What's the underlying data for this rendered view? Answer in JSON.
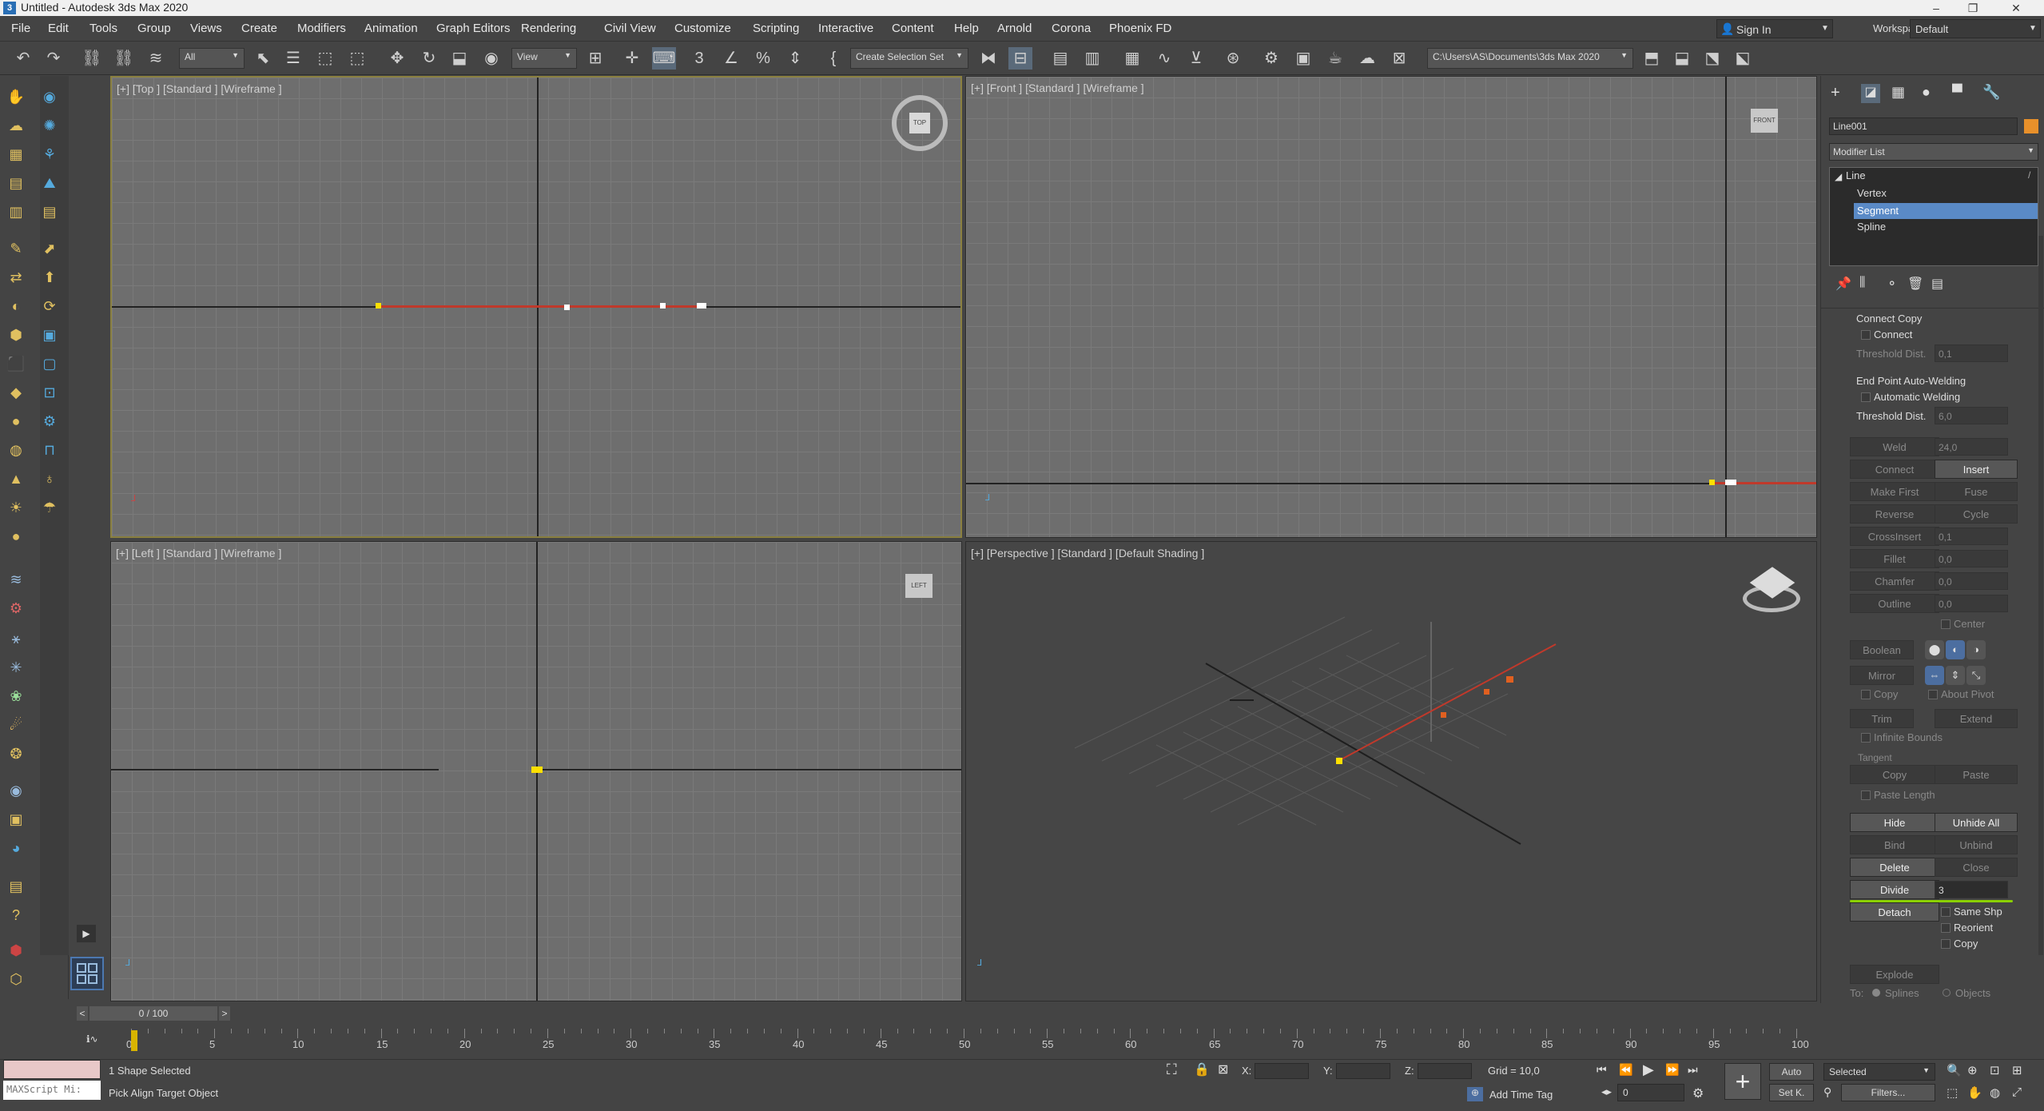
{
  "app": {
    "title": "Untitled - Autodesk 3ds Max 2020"
  },
  "menu": [
    "File",
    "Edit",
    "Tools",
    "Group",
    "Views",
    "Create",
    "Modifiers",
    "Animation",
    "Graph Editors",
    "Rendering",
    "Civil View",
    "Customize",
    "Scripting",
    "Interactive",
    "Content",
    "Help",
    "Arnold",
    "Corona",
    "Phoenix FD"
  ],
  "account": {
    "sign_in": "Sign In",
    "workspaces_label": "Workspaces:",
    "workspace": "Default"
  },
  "toolbar": {
    "filter": "All",
    "ref_coord": "View",
    "selection_set": "Create Selection Set",
    "project_path": "C:\\Users\\AS\\Documents\\3ds Max 2020"
  },
  "viewports": {
    "top": {
      "label": "[+] [Top ] [Standard ] [Wireframe ]"
    },
    "front": {
      "label": "[+] [Front ] [Standard ] [Wireframe ]"
    },
    "left": {
      "label": "[+] [Left ] [Standard ] [Wireframe ]"
    },
    "persp": {
      "label": "[+] [Perspective ] [Standard ] [Default Shading ]"
    }
  },
  "command_panel": {
    "object_name": "Line001",
    "object_color": "#e8902a",
    "modifier_list": "Modifier List",
    "stack": {
      "root": "Line",
      "items": [
        "Vertex",
        "Segment",
        "Spline"
      ],
      "selected": "Segment"
    },
    "connect_copy": {
      "title": "Connect Copy",
      "connect": "Connect",
      "threshold_label": "Threshold Dist.",
      "threshold": "0,1"
    },
    "auto_weld": {
      "title": "End Point Auto-Welding",
      "auto": "Automatic Welding",
      "threshold_label": "Threshold Dist.",
      "threshold": "6,0"
    },
    "buttons": {
      "weld": "Weld",
      "weld_val": "24,0",
      "connect": "Connect",
      "insert": "Insert",
      "make_first": "Make First",
      "fuse": "Fuse",
      "reverse": "Reverse",
      "cycle": "Cycle",
      "crossinsert": "CrossInsert",
      "crossinsert_val": "0,1",
      "fillet": "Fillet",
      "fillet_val": "0,0",
      "chamfer": "Chamfer",
      "chamfer_val": "0,0",
      "outline": "Outline",
      "outline_val": "0,0",
      "center": "Center",
      "boolean": "Boolean",
      "mirror": "Mirror",
      "copy": "Copy",
      "about_pivot": "About Pivot",
      "trim": "Trim",
      "extend": "Extend",
      "infinite_bounds": "Infinite Bounds",
      "tangent": "Tangent",
      "t_copy": "Copy",
      "t_paste": "Paste",
      "paste_length": "Paste Length",
      "hide": "Hide",
      "unhide_all": "Unhide All",
      "bind": "Bind",
      "unbind": "Unbind",
      "delete": "Delete",
      "close": "Close",
      "divide": "Divide",
      "divide_val": "3",
      "detach": "Detach",
      "same_shp": "Same Shp",
      "reorient": "Reorient",
      "d_copy": "Copy",
      "explode": "Explode",
      "to_label": "To:",
      "splines": "Splines",
      "objects": "Objects"
    }
  },
  "timeline": {
    "frame": "0 / 100",
    "ticks": [
      "0",
      "5",
      "10",
      "15",
      "20",
      "25",
      "30",
      "35",
      "40",
      "45",
      "50",
      "55",
      "60",
      "65",
      "70",
      "75",
      "80",
      "85",
      "90",
      "95",
      "100"
    ]
  },
  "status": {
    "maxscript": "MAXScript Mi:",
    "selection": "1 Shape Selected",
    "prompt": "Pick Align Target Object",
    "x_label": "X:",
    "y_label": "Y:",
    "z_label": "Z:",
    "grid": "Grid = 10,0",
    "add_time_tag": "Add Time Tag",
    "auto": "Auto",
    "set_key": "Set K.",
    "key_mode": "Selected",
    "filters": "Filters...",
    "frame_field": "0"
  }
}
